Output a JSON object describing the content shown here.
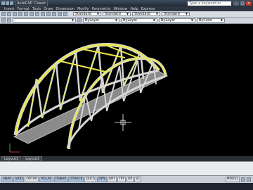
{
  "titlebar": {
    "workspace": "AutoCAD Classic",
    "search_placeholder": "Type a keyword or phrase"
  },
  "menu": [
    "Insert",
    "Format",
    "Tools",
    "Draw",
    "Dimension",
    "Modify",
    "Parametric",
    "Window",
    "Help",
    "Express"
  ],
  "toolbar1": {
    "text_style": "Standard",
    "dim_style": "Standard",
    "table_style": "Standard",
    "mleader_style": "Standard"
  },
  "toolbar2": {
    "color": "ByLayer",
    "linetype": "ByLayer",
    "lineweight": "ByLayer",
    "plotstyle": "ByColor"
  },
  "tabs": [
    "Layout1",
    "Layout2"
  ],
  "statusbar": {
    "toggles": [
      "SNAP",
      "GRID",
      "ORTHO",
      "POLAR",
      "OSNAP",
      "OTRACK",
      "DUCS",
      "DYN",
      "LWT",
      "TPY",
      "QP",
      "SC"
    ],
    "right_label": "MODEL"
  },
  "colors": {
    "arch": "#e8e84a",
    "frame": "#cfd3d9",
    "deck": "#8a8a8a"
  }
}
